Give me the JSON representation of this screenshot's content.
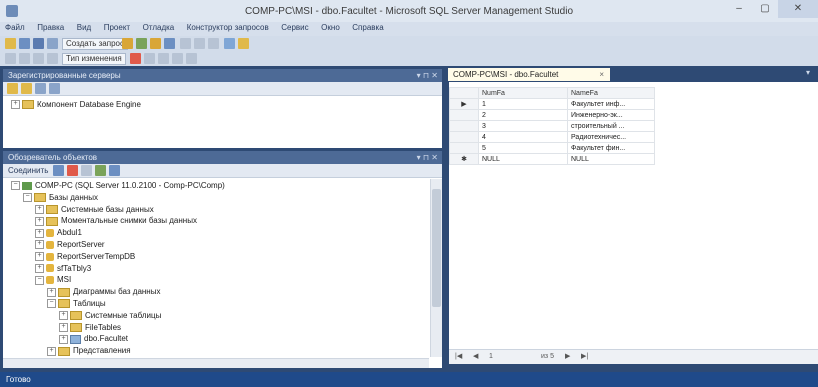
{
  "window": {
    "title": "COMP-PC\\MSI - dbo.Facultet - Microsoft SQL Server Management Studio",
    "min": "–",
    "max": "▢",
    "close": "✕"
  },
  "menu": [
    "Файл",
    "Правка",
    "Вид",
    "Проект",
    "Отладка",
    "Конструктор запросов",
    "Сервис",
    "Окно",
    "Справка"
  ],
  "toolbar": {
    "new_query": "Создать запрос",
    "change_type": "Тип изменения"
  },
  "registered_servers": {
    "title": "Зарегистрированные серверы",
    "root": "Компонент Database Engine"
  },
  "object_explorer": {
    "title": "Обозреватель объектов",
    "connect": "Соединить",
    "tree": [
      {
        "label": "COMP-PC (SQL Server 11.0.2100 - Comp-PC\\Comp)",
        "indent": 0,
        "icon": "server",
        "exp": "−"
      },
      {
        "label": "Базы данных",
        "indent": 1,
        "icon": "folder",
        "exp": "−"
      },
      {
        "label": "Системные базы данных",
        "indent": 2,
        "icon": "folder",
        "exp": "+"
      },
      {
        "label": "Моментальные снимки базы данных",
        "indent": 2,
        "icon": "folder",
        "exp": "+"
      },
      {
        "label": "Abdul1",
        "indent": 2,
        "icon": "db",
        "exp": "+"
      },
      {
        "label": "ReportServer",
        "indent": 2,
        "icon": "db",
        "exp": "+"
      },
      {
        "label": "ReportServerTempDB",
        "indent": 2,
        "icon": "db",
        "exp": "+"
      },
      {
        "label": "sfTaTbly3",
        "indent": 2,
        "icon": "db",
        "exp": "+"
      },
      {
        "label": "MSI",
        "indent": 2,
        "icon": "db",
        "exp": "−"
      },
      {
        "label": "Диаграммы баз данных",
        "indent": 3,
        "icon": "folder",
        "exp": "+"
      },
      {
        "label": "Таблицы",
        "indent": 3,
        "icon": "folder",
        "exp": "−"
      },
      {
        "label": "Системные таблицы",
        "indent": 4,
        "icon": "folder",
        "exp": "+"
      },
      {
        "label": "FileTables",
        "indent": 4,
        "icon": "folder",
        "exp": "+"
      },
      {
        "label": "dbo.Facultet",
        "indent": 4,
        "icon": "table",
        "exp": "+"
      },
      {
        "label": "Представления",
        "indent": 3,
        "icon": "folder",
        "exp": "+"
      }
    ]
  },
  "document_tab": {
    "label": "COMP-PC\\MSI - dbo.Facultet",
    "close": "×"
  },
  "grid": {
    "columns": [
      "NumFa",
      "NameFa"
    ],
    "rows": [
      {
        "indicator": "▶",
        "num": "1",
        "name": "Факультет инф..."
      },
      {
        "indicator": "",
        "num": "2",
        "name": "Инженерно-эк..."
      },
      {
        "indicator": "",
        "num": "3",
        "name": "строительный ..."
      },
      {
        "indicator": "",
        "num": "4",
        "name": "Радиотехничес..."
      },
      {
        "indicator": "",
        "num": "5",
        "name": "Факультет фин..."
      },
      {
        "indicator": "✱",
        "num": "NULL",
        "name": "NULL"
      }
    ],
    "nav": {
      "first": "|◀",
      "prev": "◀",
      "position": "1",
      "of": "из 5",
      "next": "▶",
      "last": "▶|"
    }
  },
  "status": {
    "text": "Готово"
  }
}
